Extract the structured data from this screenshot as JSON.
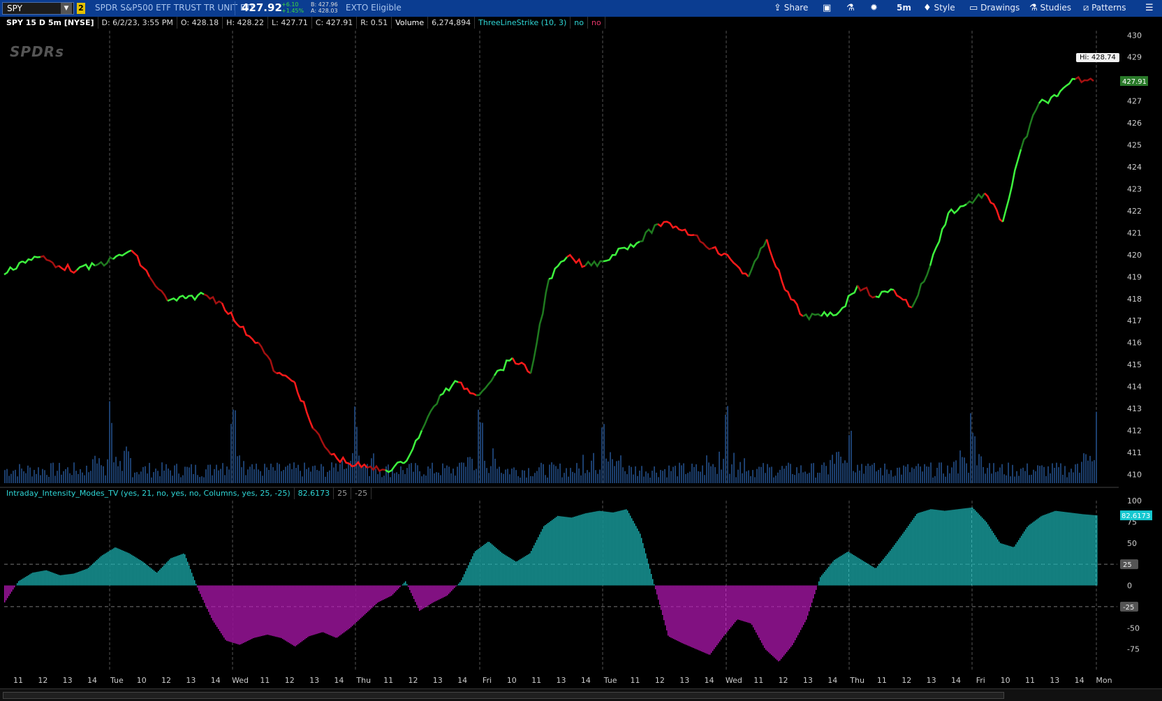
{
  "header": {
    "symbol": "SPY",
    "link_badge": "2",
    "description": "SPDR S&P500 ETF TRUST TR UNIT ETF",
    "last": "427.92",
    "net_change": "+6.10",
    "pct_change": "+1.45%",
    "bid": "B: 427.96",
    "ask": "A: 428.03",
    "exto": "EXTO Eligible",
    "share": "Share",
    "timeframe": "5m",
    "style": "Style",
    "drawings": "Drawings",
    "studies": "Studies",
    "patterns": "Patterns"
  },
  "info": {
    "title": "SPY 15 D 5m [NYSE]",
    "date": "D: 6/2/23, 3:55 PM",
    "open": "O: 428.18",
    "high": "H: 428.22",
    "low": "L: 427.71",
    "close": "C: 427.91",
    "range": "R: 0.51",
    "volume_label": "Volume",
    "volume_value": "6,274,894",
    "study": "ThreeLineStrike (10, 3)",
    "flag1": "no",
    "flag2": "no"
  },
  "lower_info": {
    "study": "Intraday_Intensity_Modes_TV (yes, 21, no, yes, no, Columns, yes, 25, -25)",
    "value": "82.6173",
    "upper": "25",
    "lower": "-25"
  },
  "labels": {
    "logo": "SPDRs",
    "high_label": "Hi: 428.74",
    "price_tag": "427.91",
    "osc_tag": "82.6173",
    "upper_tag": "25",
    "lower_tag": "-25"
  },
  "colors": {
    "up": "#3ef53e",
    "up_dark": "#1f7a1f",
    "down": "#ff1a1a",
    "down_dark": "#a31010",
    "volume": "#1c3f6e",
    "osc_pos": "#1cb5b5",
    "osc_neg": "#b818b8",
    "session": "#555555"
  },
  "chart_data": [
    {
      "type": "line",
      "title": "SPY 15 D 5m [NYSE]",
      "series": [
        {
          "name": "SPY",
          "values": [
            419.1,
            419.7,
            419.9,
            419.5,
            419.3,
            419.5,
            419.8,
            420.2,
            419.0,
            417.9,
            418.0,
            418.2,
            417.8,
            416.7,
            416.0,
            414.6,
            414.2,
            412.1,
            410.9,
            410.5,
            410.3,
            410.2,
            410.5,
            412.0,
            413.6,
            414.2,
            413.6,
            414.5,
            415.3,
            414.6,
            418.9,
            419.9,
            419.5,
            419.7,
            420.3,
            420.6,
            421.4,
            421.3,
            420.9,
            420.3,
            419.8,
            419.0,
            420.7,
            418.4,
            417.2,
            417.2,
            417.4,
            418.6,
            418.1,
            418.4,
            417.6,
            419.5,
            421.9,
            422.3,
            422.8,
            421.5,
            424.8,
            426.9,
            427.2,
            428.0,
            427.91
          ]
        }
      ],
      "ylim": [
        409.6,
        430.2
      ],
      "yticks": [
        410,
        411,
        412,
        413,
        414,
        415,
        416,
        417,
        418,
        419,
        420,
        421,
        422,
        423,
        424,
        425,
        426,
        427,
        428,
        429,
        430
      ],
      "session_separators": [
        "Tue",
        "Wed",
        "Thu",
        "Fri",
        "Tue",
        "Wed",
        "Thu",
        "Fri",
        "Mon"
      ],
      "xtick_labels": [
        "11",
        "12",
        "13",
        "14",
        "Tue",
        "10",
        "12",
        "13",
        "14",
        "Wed",
        "11",
        "12",
        "13",
        "14",
        "Thu",
        "11",
        "12",
        "13",
        "14",
        "Fri",
        "10",
        "11",
        "13",
        "14",
        "Tue",
        "11",
        "12",
        "13",
        "14",
        "Wed",
        "11",
        "12",
        "13",
        "14",
        "Thu",
        "11",
        "12",
        "13",
        "14",
        "Fri",
        "10",
        "11",
        "13",
        "14",
        "Mon"
      ],
      "high": 428.74,
      "last": 427.91
    },
    {
      "type": "bar",
      "title": "Intraday_Intensity_Modes_TV",
      "values": [
        -20,
        5,
        15,
        18,
        12,
        14,
        20,
        35,
        45,
        38,
        28,
        15,
        32,
        38,
        -5,
        -40,
        -65,
        -70,
        -62,
        -58,
        -62,
        -72,
        -60,
        -55,
        -62,
        -50,
        -35,
        -20,
        -12,
        5,
        -30,
        -20,
        -12,
        5,
        40,
        52,
        38,
        28,
        38,
        70,
        82,
        80,
        85,
        88,
        86,
        90,
        60,
        0,
        -60,
        -68,
        -75,
        -82,
        -60,
        -40,
        -45,
        -75,
        -90,
        -70,
        -40,
        10,
        30,
        40,
        30,
        20,
        40,
        62,
        85,
        90,
        88,
        90,
        92,
        75,
        50,
        45,
        70,
        82,
        88,
        86,
        84,
        82.6173
      ],
      "ylim": [
        -100,
        100
      ],
      "yticks": [
        100,
        75,
        50,
        25,
        0,
        -25,
        -50,
        -75
      ],
      "upper_band": 25,
      "lower_band": -25,
      "last": 82.6173
    }
  ]
}
